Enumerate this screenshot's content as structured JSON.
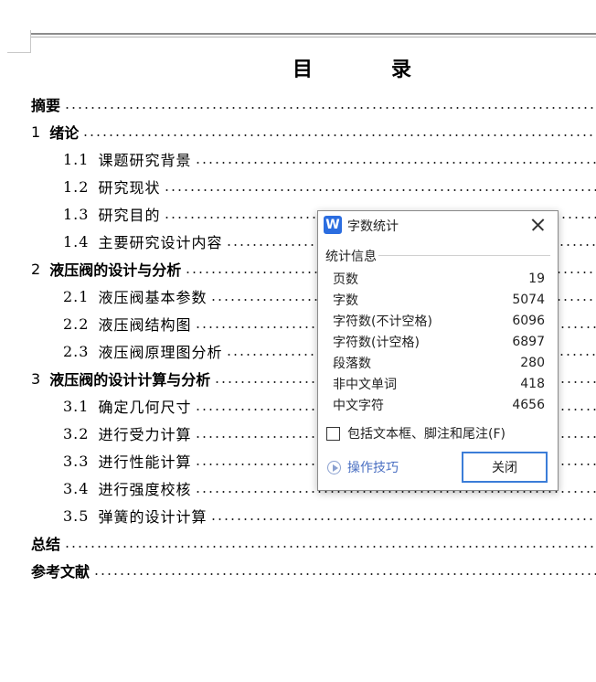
{
  "document": {
    "toc_title_chars": [
      "目",
      "录"
    ],
    "entries": [
      {
        "level": 1,
        "num": "",
        "label": "摘要"
      },
      {
        "level": 1,
        "num": "1",
        "label": "绪论"
      },
      {
        "level": 2,
        "num": "1.1",
        "label": "课题研究背景"
      },
      {
        "level": 2,
        "num": "1.2",
        "label": "研究现状"
      },
      {
        "level": 2,
        "num": "1.3",
        "label": "研究目的"
      },
      {
        "level": 2,
        "num": "1.4",
        "label": "主要研究设计内容"
      },
      {
        "level": 1,
        "num": "2",
        "label": "液压阀的设计与分析"
      },
      {
        "level": 2,
        "num": "2.1",
        "label": "液压阀基本参数"
      },
      {
        "level": 2,
        "num": "2.2",
        "label": "液压阀结构图"
      },
      {
        "level": 2,
        "num": "2.3",
        "label": "液压阀原理图分析"
      },
      {
        "level": 1,
        "num": "3",
        "label": "液压阀的设计计算与分析"
      },
      {
        "level": 2,
        "num": "3.1",
        "label": "确定几何尺寸"
      },
      {
        "level": 2,
        "num": "3.2",
        "label": "进行受力计算"
      },
      {
        "level": 2,
        "num": "3.3",
        "label": "进行性能计算"
      },
      {
        "level": 2,
        "num": "3.4",
        "label": "进行强度校核"
      },
      {
        "level": 2,
        "num": "3.5",
        "label": "弹簧的设计计算"
      },
      {
        "level": 1,
        "num": "",
        "label": "总结"
      },
      {
        "level": 1,
        "num": "",
        "label": "参考文献"
      }
    ]
  },
  "dialog": {
    "icon_letter": "W",
    "icon": "wps-writer-icon",
    "title": "字数统计",
    "group_label": "统计信息",
    "stats": [
      {
        "label": "页数",
        "value": "19"
      },
      {
        "label": "字数",
        "value": "5074"
      },
      {
        "label": "字符数(不计空格)",
        "value": "6096"
      },
      {
        "label": "字符数(计空格)",
        "value": "6897"
      },
      {
        "label": "段落数",
        "value": "280"
      },
      {
        "label": "非中文单词",
        "value": "418"
      },
      {
        "label": "中文字符",
        "value": "4656"
      }
    ],
    "checkbox_label": "包括文本框、脚注和尾注(F)",
    "checkbox_checked": false,
    "tips_label": "操作技巧",
    "close_button_label": "关闭"
  },
  "colors": {
    "accent": "#3b7dd8",
    "link": "#4a6fc2",
    "app_icon": "#2b6de0"
  }
}
